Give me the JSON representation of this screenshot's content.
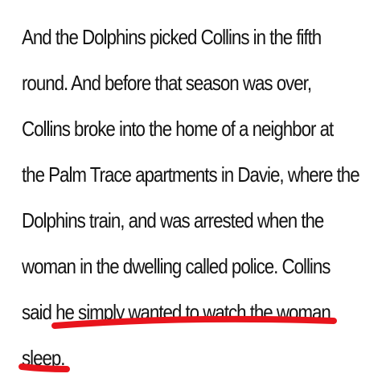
{
  "article": {
    "lines": [
      "And the Dolphins picked Collins in the fifth",
      "round. And before that season was over,",
      "Collins broke into the home of a neighbor at",
      "the Palm Trace apartments in Davie, where the",
      "Dolphins train, and was arrested when the",
      "woman in the dwelling called police. Collins",
      "said he simply wanted to watch the woman",
      "sleep."
    ]
  },
  "annotation": {
    "color": "#e8141c",
    "highlighted_text": "he simply wanted to watch the woman sleep."
  }
}
